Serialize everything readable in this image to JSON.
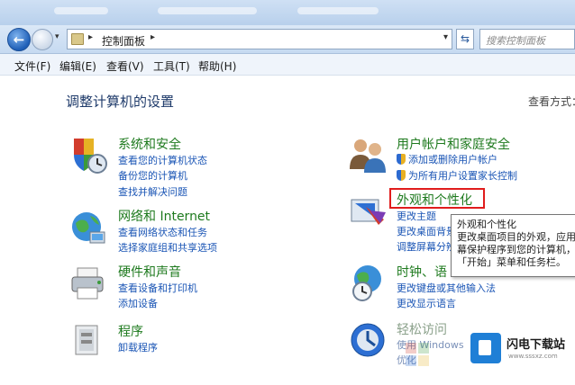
{
  "address": {
    "crumb": "控制面板",
    "search_placeholder": "搜索控制面板"
  },
  "menu": [
    "文件(F)",
    "编辑(E)",
    "查看(V)",
    "工具(T)",
    "帮助(H)"
  ],
  "page_title": "调整计算机的设置",
  "view_by": "查看方式：",
  "left_categories": [
    {
      "title": "系统和安全",
      "links": [
        "查看您的计算机状态",
        "备份您的计算机",
        "查找并解决问题"
      ]
    },
    {
      "title": "网络和 Internet",
      "links": [
        "查看网络状态和任务",
        "选择家庭组和共享选项"
      ]
    },
    {
      "title": "硬件和声音",
      "links": [
        "查看设备和打印机",
        "添加设备"
      ]
    },
    {
      "title": "程序",
      "links": [
        "卸载程序"
      ]
    }
  ],
  "right_categories": [
    {
      "title": "用户帐户和家庭安全",
      "links": [
        "添加或删除用户帐户",
        "为所有用户设置家长控制"
      ]
    },
    {
      "title": "外观和个性化",
      "links": [
        "更改主题",
        "更改桌面背景",
        "调整屏幕分辨"
      ]
    },
    {
      "title": "时钟、语",
      "links": [
        "更改键盘或其他输入法",
        "更改显示语言"
      ]
    },
    {
      "title": "轻松访问",
      "links": [
        "使用 Windows",
        "优化"
      ]
    }
  ],
  "tooltip": {
    "lines": [
      "外观和个性化",
      "更改桌面项目的外观，应用",
      "幕保护程序到您的计算机，",
      "「开始」菜单和任务栏。"
    ]
  },
  "watermark": {
    "name": "闪电下载站",
    "url": "www.sssxz.com"
  },
  "colors": {
    "category_title": "#1e7a1e",
    "link": "#1a55b5",
    "highlight": "#e01c1c"
  }
}
